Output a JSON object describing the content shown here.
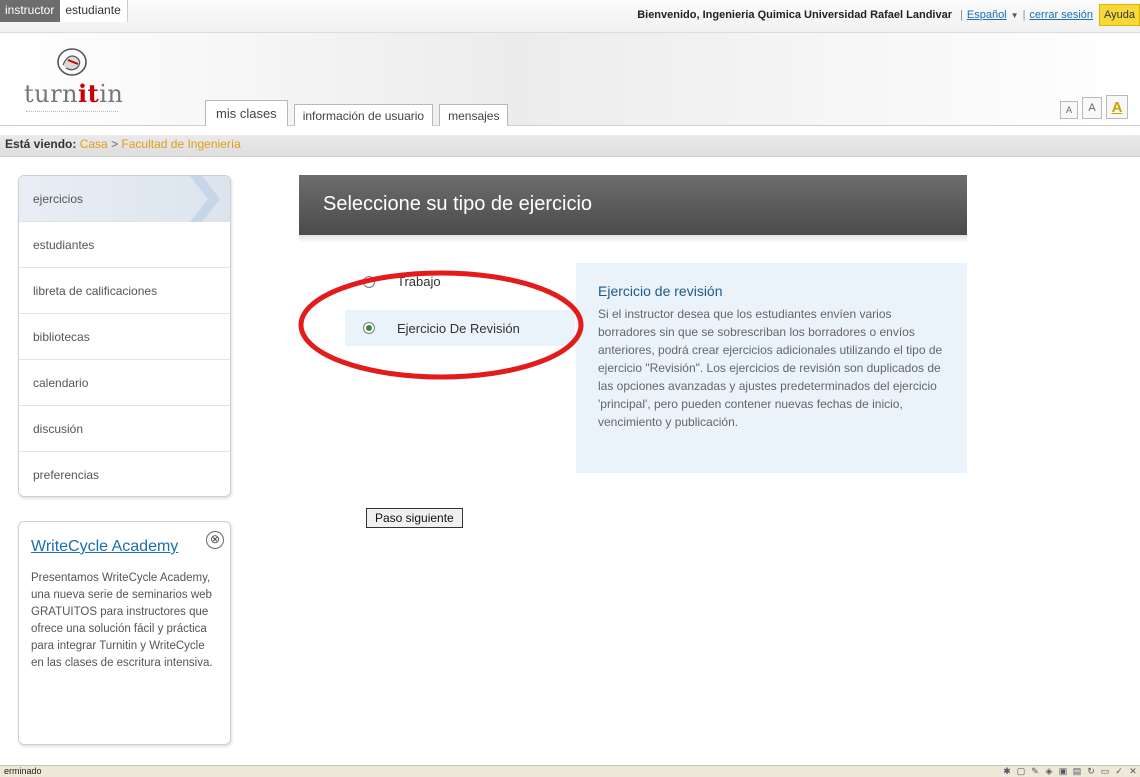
{
  "roles": {
    "instructor": "instructor",
    "student": "estudiante"
  },
  "welcome": {
    "greeting": "Bienvenido, Ingenieria Quimica Universidad Rafael Landivar",
    "language": "Español",
    "logout": "cerrar sesión",
    "help": "Ayuda"
  },
  "logo": {
    "prefix": "turn",
    "highlight": "it",
    "suffix": "in"
  },
  "tabs": {
    "classes": "mis clases",
    "user_info": "información de usuario",
    "messages": "mensajes"
  },
  "font_buttons": {
    "small": "A",
    "medium": "A",
    "large": "A"
  },
  "breadcrumb": {
    "label": "Está viendo:",
    "home": "Casa",
    "separator": ">",
    "current": "Facultad de Ingeniería"
  },
  "sidebar": {
    "items": [
      {
        "label": "ejercicios"
      },
      {
        "label": "estudiantes"
      },
      {
        "label": "libreta de calificaciones"
      },
      {
        "label": "bibliotecas"
      },
      {
        "label": "calendario"
      },
      {
        "label": "discusión"
      },
      {
        "label": "preferencias"
      }
    ]
  },
  "promo": {
    "title": "WriteCycle Academy",
    "close_glyph": "⊗",
    "text": "Presentamos WriteCycle Academy, una nueva serie de seminarios web GRATUITOS para instructores que ofrece una solución fácil y práctica para integrar Turnitin y WriteCycle en las clases de escritura intensiva."
  },
  "main": {
    "title": "Seleccione su tipo de ejercicio",
    "options": {
      "paper": "Trabajo",
      "revision": "Ejercicio De Revisión"
    },
    "selected": "revision",
    "info_title": "Ejercicio de revisión",
    "info_text": "Si el instructor desea que los estudiantes envíen varios borradores sin que se sobrescriban los borradores o envíos anteriores, podrá crear ejercicios adicionales utilizando el tipo de ejercicio \"Revisión\". Los ejercicios de revisión son duplicados de las opciones avanzadas y ajustes predeterminados del ejercicio 'principal', pero pueden contener nuevas fechas de inicio, vencimiento y publicación.",
    "next_button": "Paso siguiente",
    "annotation_color": "#e31b1b"
  },
  "statusbar": {
    "text": "erminado"
  },
  "colors": {
    "accent_link": "#1a6fb0",
    "breadcrumb_link": "#e49b1a",
    "help_bg": "#f7d83a",
    "header_dark": "#5a5a5a",
    "info_bg": "#eaf2fa"
  }
}
